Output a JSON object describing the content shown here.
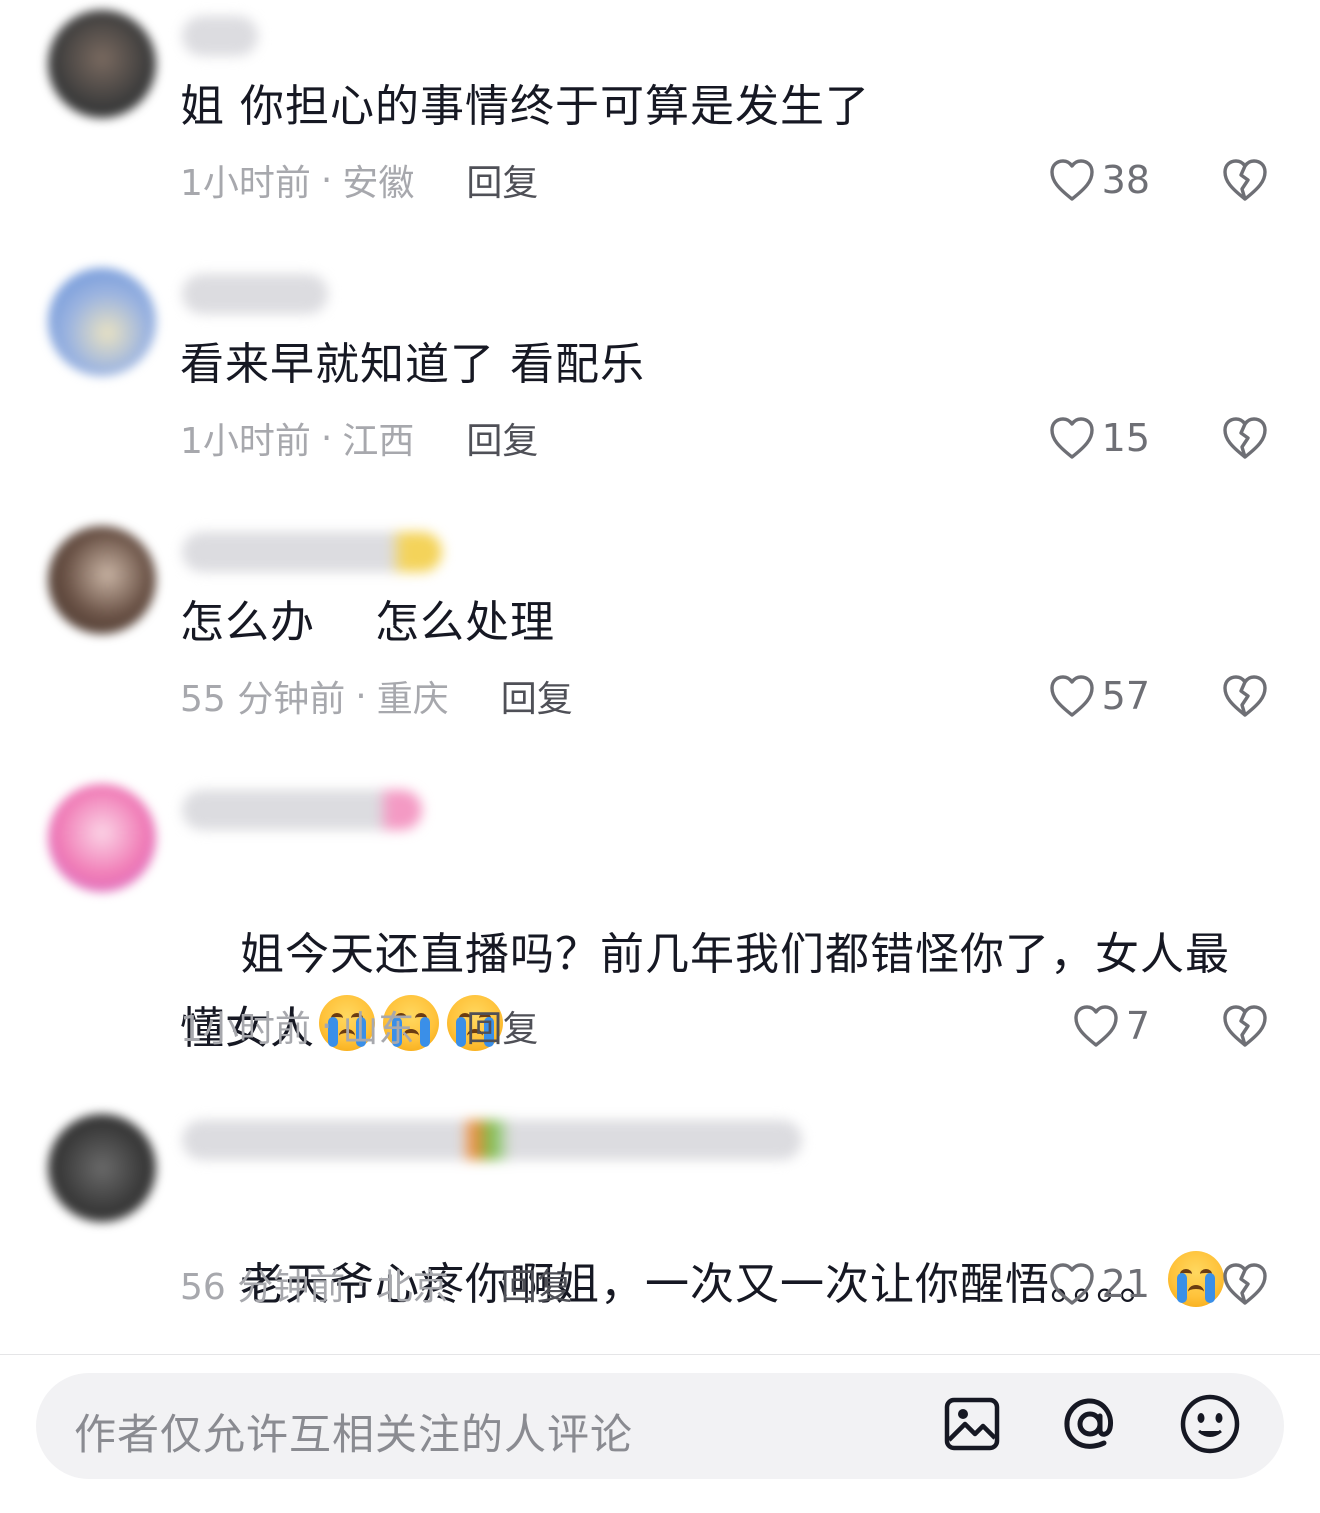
{
  "comments": [
    {
      "avatar_colors": [
        "#2a2a2a",
        "#7a6a60"
      ],
      "username_color": "#d9d9dc",
      "text": "姐 你担心的事情终于可算是发生了",
      "time": "1小时前",
      "location": "安徽",
      "reply_label": "回复",
      "likes": "38"
    },
    {
      "avatar_colors": [
        "#5b8ad8",
        "#e9e2c2"
      ],
      "username_color": "#d9d9dc",
      "text": "看来早就知道了 看配乐",
      "time": "1小时前",
      "location": "江西",
      "reply_label": "回复",
      "likes": "15"
    },
    {
      "avatar_colors": [
        "#3a2a22",
        "#c8b3a3"
      ],
      "username_color": "#d9d9dc",
      "text": "怎么办    怎么处理",
      "time": "55 分钟前",
      "location": "重庆",
      "reply_label": "回复",
      "likes": "57"
    },
    {
      "avatar_colors": [
        "#f07ab5",
        "#fbd4e6"
      ],
      "username_color": "#d9d9dc",
      "text": "姐今天还直播吗？前几年我们都错怪你了，女人最懂女人",
      "emoji_count": 3,
      "time": "1小时前",
      "location": "山东",
      "reply_label": "回复",
      "likes": "7"
    },
    {
      "avatar_colors": [
        "#2e2e2e",
        "#9a9a9a"
      ],
      "username_color": "#d9d9dc",
      "text": "老天爷心疼你啊姐，一次又一次让你醒悟。。。。",
      "emoji_count": 1,
      "time": "56 分钟前",
      "location": "北京",
      "reply_label": "回复",
      "likes": "21"
    }
  ],
  "meta_separator": "·",
  "input": {
    "placeholder": "作者仅允许互相关注的人评论"
  },
  "icons": {
    "like": "heart-outline-icon",
    "dislike": "broken-heart-icon",
    "emoji": "loudly-crying-face-emoji",
    "image": "image-icon",
    "mention": "at-sign-icon",
    "emoji_picker": "smiley-face-icon"
  },
  "colors": {
    "text_primary": "#161823",
    "text_secondary": "#a7a8ad",
    "reply": "#4f5057",
    "input_bg": "#f2f2f4"
  }
}
